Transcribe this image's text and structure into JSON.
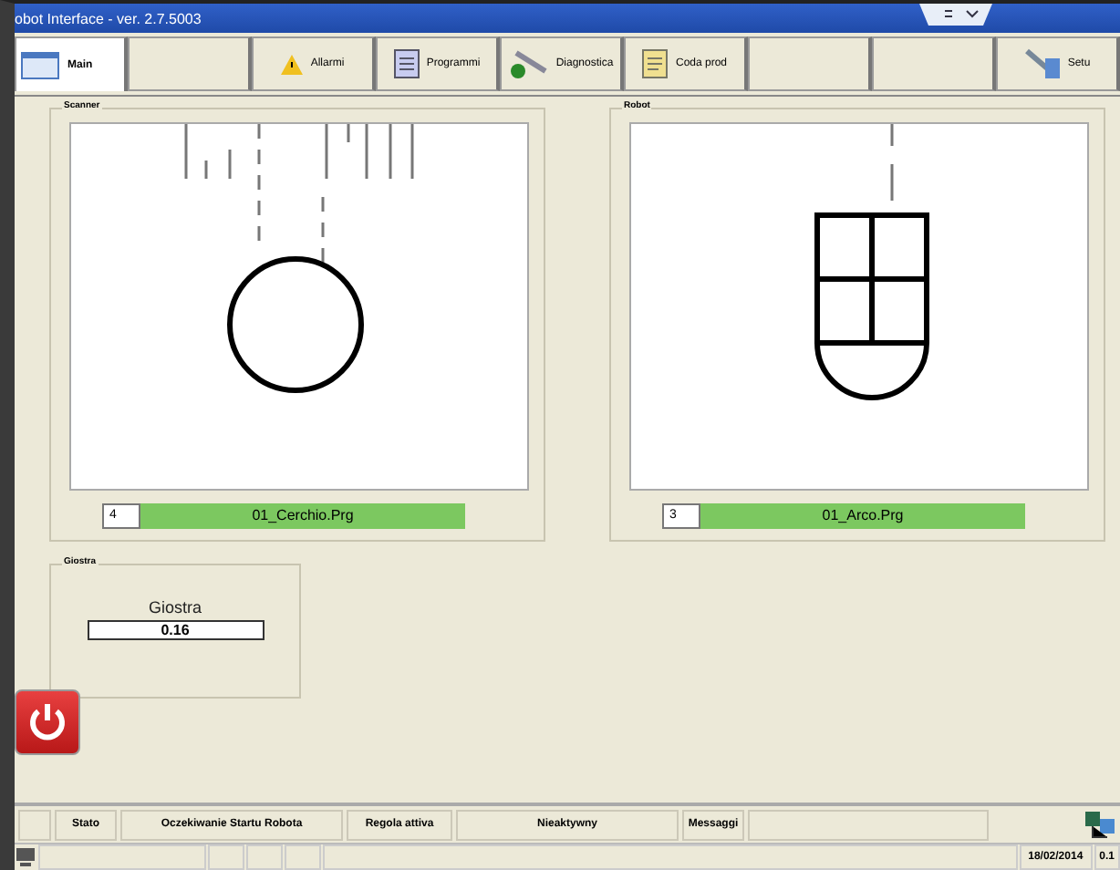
{
  "window": {
    "title": "obot Interface - ver. 2.7.5003"
  },
  "tabs": [
    {
      "label": "Main",
      "kind": "window",
      "selected": true
    },
    {
      "kind": "blank",
      "selected": false
    },
    {
      "label": "Allarmi",
      "kind": "warning",
      "selected": false
    },
    {
      "label": "Programmi",
      "kind": "list",
      "selected": false
    },
    {
      "label": "Diagnostica",
      "kind": "wrench",
      "selected": false
    },
    {
      "label": "Coda prod",
      "kind": "note",
      "selected": false
    },
    {
      "kind": "blank",
      "selected": false
    },
    {
      "kind": "blank",
      "selected": false
    },
    {
      "label": "Setu",
      "kind": "tools",
      "selected": false
    }
  ],
  "panels": [
    {
      "title": "Scanner",
      "kind": "circle",
      "number": "4",
      "program": "01_Cerchio.Prg"
    },
    {
      "title": "Robot",
      "kind": "arch",
      "number": "3",
      "program": "01_Arco.Prg"
    }
  ],
  "giostra": {
    "title": "Giostra",
    "label": "Giostra",
    "value": "0.16"
  },
  "status_bar": [
    {
      "label": "Stato",
      "value": "Oczekiwanie Startu Robota"
    },
    {
      "label": "Regola attiva",
      "value": "Nieaktywny"
    },
    {
      "label": "Messaggi"
    }
  ],
  "footer": {
    "date": "18/02/2014",
    "time": "0.1"
  }
}
